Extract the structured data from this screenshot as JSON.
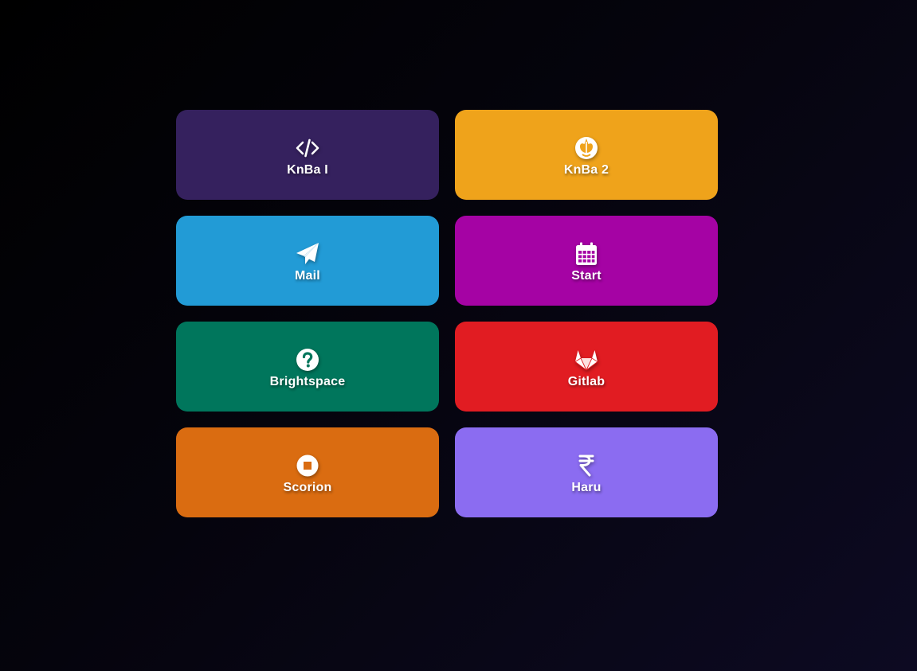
{
  "tiles": [
    {
      "label": "KnBa I",
      "icon": "code-icon",
      "color": "#35215e"
    },
    {
      "label": "KnBa 2",
      "icon": "rebel-alliance-icon",
      "color": "#efa31b"
    },
    {
      "label": "Mail",
      "icon": "paper-plane-icon",
      "color": "#229bd6"
    },
    {
      "label": "Start",
      "icon": "calendar-icon",
      "color": "#a503a4"
    },
    {
      "label": "Brightspace",
      "icon": "question-circle-icon",
      "color": "#00765c"
    },
    {
      "label": "Gitlab",
      "icon": "gitlab-icon",
      "color": "#e11c22"
    },
    {
      "label": "Scorion",
      "icon": "stop-circle-icon",
      "color": "#da6c11"
    },
    {
      "label": "Haru",
      "icon": "rupee-icon",
      "color": "#8b6cf1"
    }
  ]
}
